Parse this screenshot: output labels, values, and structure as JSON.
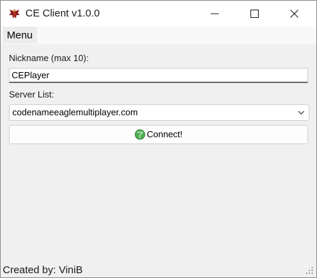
{
  "window": {
    "title": "CE Client v1.0.0",
    "app_icon": "eagle-icon",
    "controls": {
      "minimize_icon": "minimize-icon",
      "maximize_icon": "maximize-icon",
      "close_icon": "close-icon"
    }
  },
  "menubar": {
    "items": [
      {
        "label": "Menu"
      }
    ]
  },
  "form": {
    "nickname_label": "Nickname (max 10):",
    "nickname_value": "CEPlayer",
    "server_list_label": "Server List:",
    "server_selected": "codenameeaglemultiplayer.com",
    "connect_label": "Connect!",
    "connect_icon": "globe-icon"
  },
  "footer": {
    "credit": "Created by: ViniB"
  },
  "colors": {
    "window_bg": "#f0f0f0",
    "titlebar_bg": "#ffffff",
    "input_bg": "#ffffff",
    "accent_icon": "#3aa33a"
  }
}
